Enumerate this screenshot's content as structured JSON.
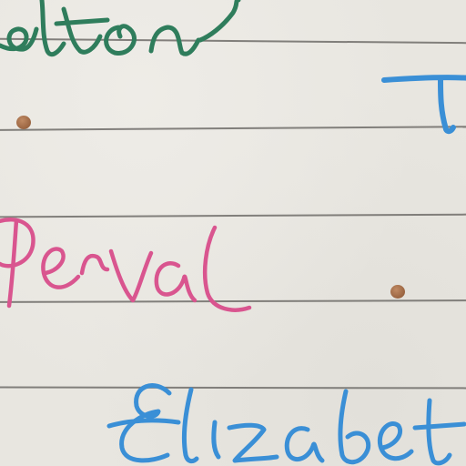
{
  "words": {
    "top": "alton",
    "middle": "Perval",
    "bottom": "Elizabet",
    "right_fragment": "T"
  },
  "ink_colors": {
    "green": "#2f7d5c",
    "pink": "#d9558f",
    "blue": "#3a8fd6"
  },
  "paper_color": "#e8e6e0",
  "rule_color": "#6f6c69",
  "dot_color": "#a06a45"
}
